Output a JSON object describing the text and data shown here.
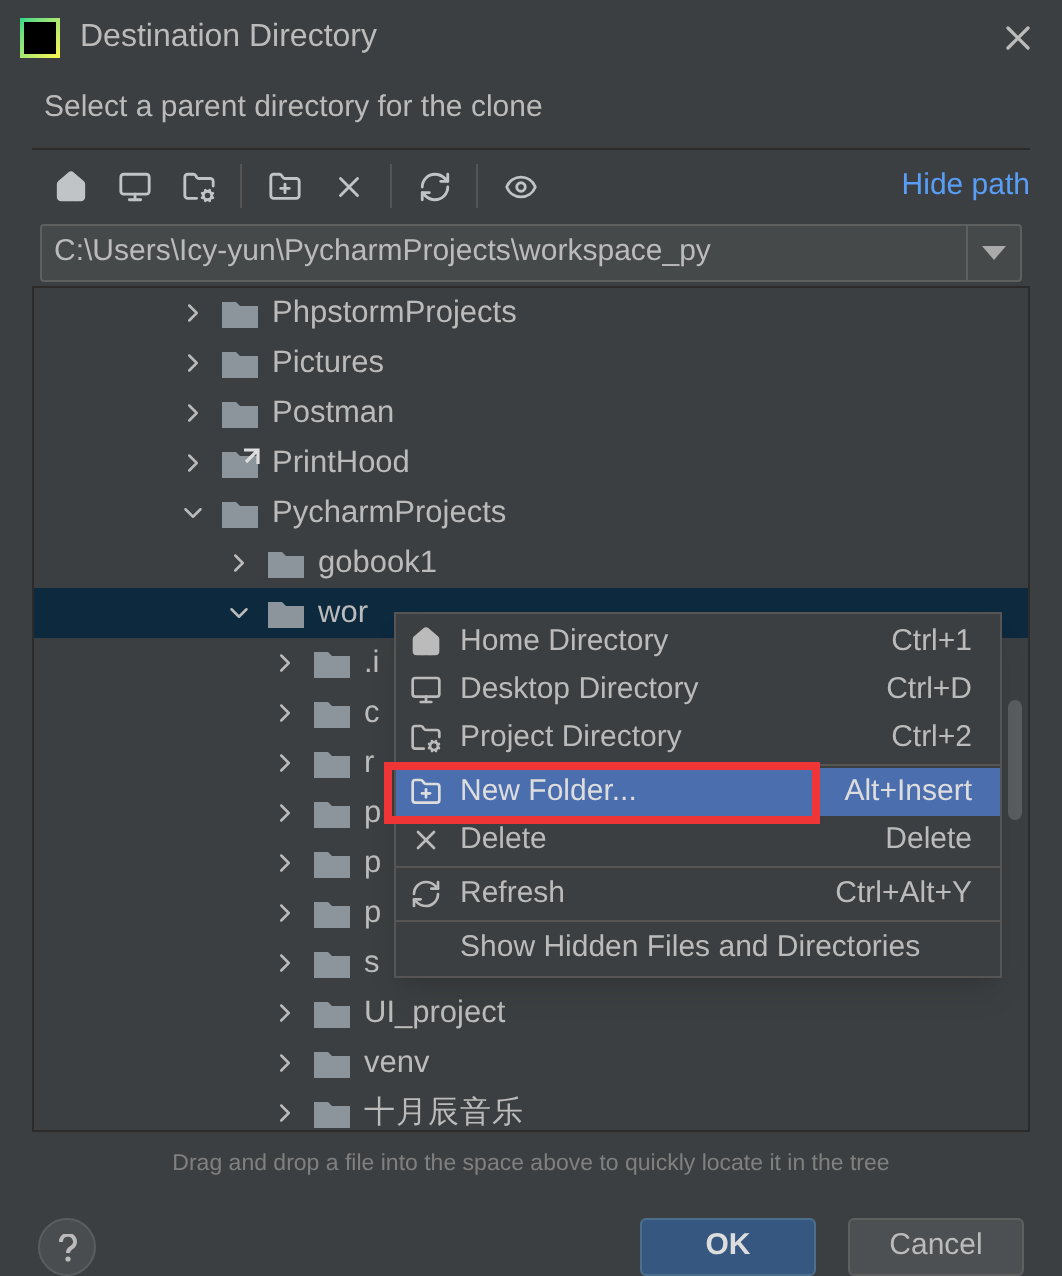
{
  "window": {
    "title": "Destination Directory"
  },
  "subtitle": "Select a parent directory for the clone",
  "toolbar": {
    "buttons": [
      {
        "kind": "home"
      },
      {
        "kind": "desktop"
      },
      {
        "kind": "project"
      },
      {
        "kind": "separator"
      },
      {
        "kind": "new-folder"
      },
      {
        "kind": "delete"
      },
      {
        "kind": "separator"
      },
      {
        "kind": "refresh"
      },
      {
        "kind": "separator"
      },
      {
        "kind": "hidden"
      }
    ],
    "link": "Hide path"
  },
  "path_field": {
    "value": "C:\\Users\\Icy-yun\\PycharmProjects\\workspace_py"
  },
  "tree": {
    "items": [
      {
        "name": "PhpstormProjects",
        "kind": "folder",
        "expanded": false,
        "selected": false
      },
      {
        "name": "Pictures",
        "kind": "folder",
        "expanded": false,
        "selected": false
      },
      {
        "name": "Postman",
        "kind": "folder",
        "expanded": false,
        "selected": false
      },
      {
        "name": "PrintHood",
        "kind": "shortcut",
        "expanded": false,
        "selected": false
      },
      {
        "name": "PycharmProjects",
        "kind": "folder",
        "expanded": true,
        "selected": false,
        "children": [
          {
            "name": "gobook1",
            "kind": "folder",
            "expanded": false,
            "selected": false
          },
          {
            "name": "wor",
            "kind": "folder",
            "expanded": true,
            "selected": true,
            "children": [
              {
                "name": ".i",
                "kind": "folder",
                "expanded": false,
                "selected": false
              },
              {
                "name": "c",
                "kind": "folder",
                "expanded": false,
                "selected": false
              },
              {
                "name": "r",
                "kind": "folder",
                "expanded": false,
                "selected": false
              },
              {
                "name": "p",
                "kind": "folder",
                "expanded": false,
                "selected": false
              },
              {
                "name": "p",
                "kind": "folder",
                "expanded": false,
                "selected": false
              },
              {
                "name": "p",
                "kind": "folder",
                "expanded": false,
                "selected": false
              },
              {
                "name": "s",
                "kind": "folder",
                "expanded": false,
                "selected": false
              },
              {
                "name": "UI_project",
                "kind": "folder",
                "expanded": false,
                "selected": false
              },
              {
                "name": "venv",
                "kind": "folder",
                "expanded": false,
                "selected": false
              },
              {
                "name": "十月辰音乐",
                "kind": "folder",
                "expanded": false,
                "selected": false
              }
            ]
          }
        ]
      }
    ]
  },
  "context_menu": {
    "items": [
      {
        "kind": "home",
        "label": "Home Directory",
        "shortcut": "Ctrl+1",
        "selected": false,
        "annotated": false
      },
      {
        "kind": "desktop",
        "label": "Desktop Directory",
        "shortcut": "Ctrl+D",
        "selected": false,
        "annotated": false
      },
      {
        "kind": "project",
        "label": "Project Directory",
        "shortcut": "Ctrl+2",
        "selected": false,
        "annotated": false
      },
      {
        "kind": "separator"
      },
      {
        "kind": "new-folder",
        "label": "New Folder...",
        "shortcut": "Alt+Insert",
        "selected": true,
        "annotated": true
      },
      {
        "kind": "delete",
        "label": "Delete",
        "shortcut": "Delete",
        "selected": false,
        "annotated": false
      },
      {
        "kind": "separator"
      },
      {
        "kind": "refresh",
        "label": "Refresh",
        "shortcut": "Ctrl+Alt+Y",
        "selected": false,
        "annotated": false
      },
      {
        "kind": "separator"
      },
      {
        "kind": "plain",
        "label": "Show Hidden Files and Directories",
        "selected": false,
        "annotated": false
      }
    ]
  },
  "hint": "Drag and drop a file into the space above to quickly locate it in the tree",
  "buttons": [
    {
      "label": "OK",
      "default": true
    },
    {
      "label": "Cancel",
      "default": false
    }
  ]
}
